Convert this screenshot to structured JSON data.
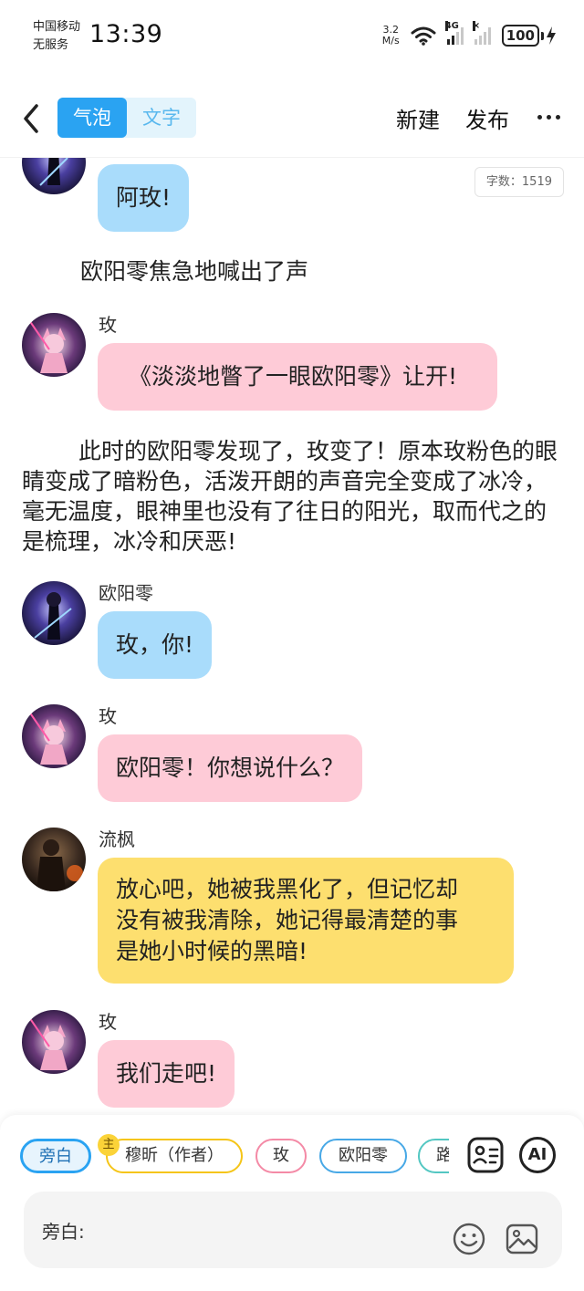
{
  "status_bar": {
    "carrier_line1": "中国移动",
    "carrier_line2": "无服务",
    "time": "13:39",
    "net_speed_value": "3.2",
    "net_speed_unit": "M/s",
    "network_tag": "4G",
    "battery": "100"
  },
  "header": {
    "tab_bubble": "气泡",
    "tab_text": "文字",
    "new_button": "新建",
    "publish_button": "发布",
    "active_tab": "气泡"
  },
  "word_count": "字数：1519",
  "messages": [
    {
      "type": "bubble",
      "speaker": "",
      "text": "阿玫!",
      "color": "#a9dcfb",
      "avatar": "ouyangling-avatar"
    },
    {
      "type": "narration",
      "text": "欧阳零焦急地喊出了声"
    },
    {
      "type": "bubble",
      "speaker": "玫",
      "text": "《淡淡地瞥了一眼欧阳零》让开!",
      "color": "#fecbd7",
      "avatar": "mei-avatar"
    },
    {
      "type": "narration",
      "text": "此时的欧阳零发现了，玫变了！原本玫粉色的眼睛变成了暗粉色，活泼开朗的声音完全变成了冰冷，毫无温度，眼神里也没有了往日的阳光，取而代之的是梳理，冰冷和厌恶!"
    },
    {
      "type": "bubble",
      "speaker": "欧阳零",
      "text": "玫，你!",
      "color": "#a9dcfb",
      "avatar": "ouyangling-avatar"
    },
    {
      "type": "bubble",
      "speaker": "玫",
      "text": "欧阳零！你想说什么？",
      "color": "#fecbd7",
      "avatar": "mei-avatar"
    },
    {
      "type": "bubble",
      "speaker": "流枫",
      "text_lines": [
        "放心吧，她被我黑化了，但记忆却",
        "没有被我清除，她记得最清楚的事",
        "是她小时候的黑暗!"
      ],
      "color": "#fddf6f",
      "avatar": "liufeng-avatar"
    },
    {
      "type": "bubble",
      "speaker": "玫",
      "text": "我们走吧!",
      "color": "#fecbd7",
      "avatar": "mei-avatar"
    }
  ],
  "character_chips": [
    {
      "label": "旁白",
      "color": "#2aa3f2",
      "selected": true
    },
    {
      "label": "穆昕（作者）",
      "color": "#f5c518",
      "badge": "主"
    },
    {
      "label": "玫",
      "color": "#f48aa6"
    },
    {
      "label": "欧阳零",
      "color": "#47a8e6"
    },
    {
      "label": "路",
      "color": "#53c7c2"
    }
  ],
  "tools": {
    "roles_icon": "contact-card-icon",
    "ai_label": "AI"
  },
  "input": {
    "label": "旁白:",
    "emoji_icon": "smile-icon",
    "image_icon": "image-icon"
  }
}
